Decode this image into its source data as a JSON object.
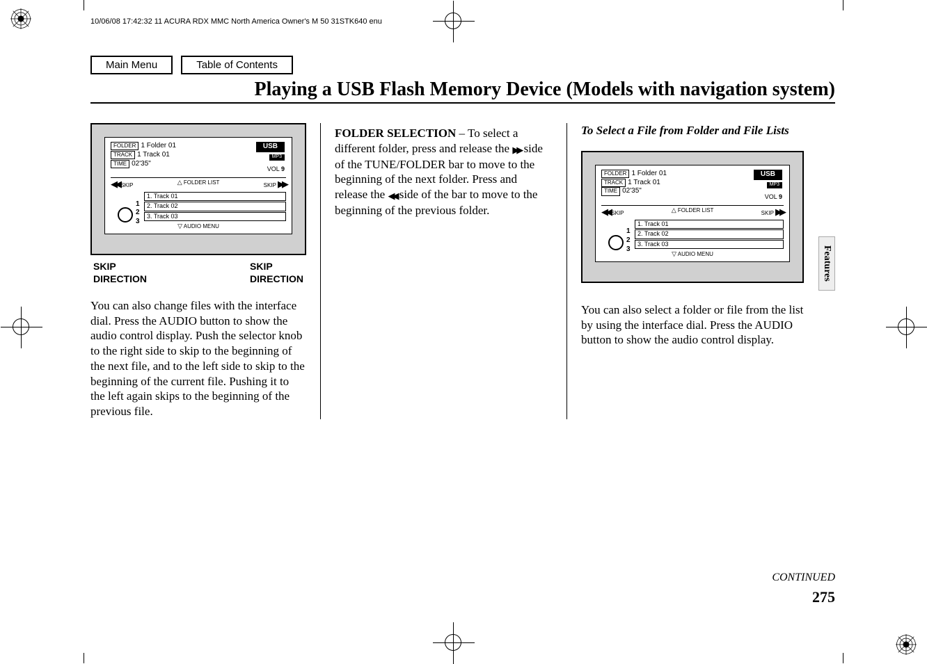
{
  "meta": {
    "header": "10/06/08 17:42:32   11 ACURA RDX MMC North America Owner's M 50 31STK640 enu"
  },
  "nav": {
    "main_menu": "Main Menu",
    "toc": "Table of Contents"
  },
  "title": "Playing a USB Flash Memory Device (Models with navigation system)",
  "side_tab": "Features",
  "continued": "CONTINUED",
  "page_number": "275",
  "display": {
    "folder_label": "FOLDER",
    "track_label": "TRACK",
    "time_label": "TIME",
    "folder_value": "1 Folder 01",
    "track_value": "1 Track 01",
    "time_value": "02'35\"",
    "usb": "USB",
    "mp3": "MP3",
    "vol_label": "VOL",
    "vol_value": "9",
    "skip_left": "SKIP",
    "folder_list": "FOLDER LIST",
    "skip_right": "SKIP",
    "tracks": [
      "1.  Track 01",
      "2.  Track 02",
      "3.  Track 03"
    ],
    "audio_menu": "AUDIO MENU",
    "nums": [
      "1",
      "2",
      "3"
    ]
  },
  "skip_labels": {
    "left_line1": "SKIP",
    "left_line2": "DIRECTION",
    "right_line1": "SKIP",
    "right_line2": "DIRECTION"
  },
  "col1": {
    "body": "You can also change files with the interface dial. Press the AUDIO button to show the audio control display. Push the selector knob to the right side to skip to the beginning of the next file, and to the left side to skip to the beginning of the current file. Pushing it to the left again skips to the beginning of the previous file."
  },
  "col2": {
    "heading": "FOLDER SELECTION",
    "dash": " – ",
    "body_a": "To select a different folder, press and release the ",
    "body_b": " side of the TUNE/FOLDER bar to move to the beginning of the next folder. Press and release the ",
    "body_c": " side of the bar to move to the beginning of the previous folder."
  },
  "col3": {
    "heading": "To Select a File from Folder and File Lists",
    "body": "You can also select a folder or file from the list by using the interface dial. Press the AUDIO button to show the audio control display."
  }
}
